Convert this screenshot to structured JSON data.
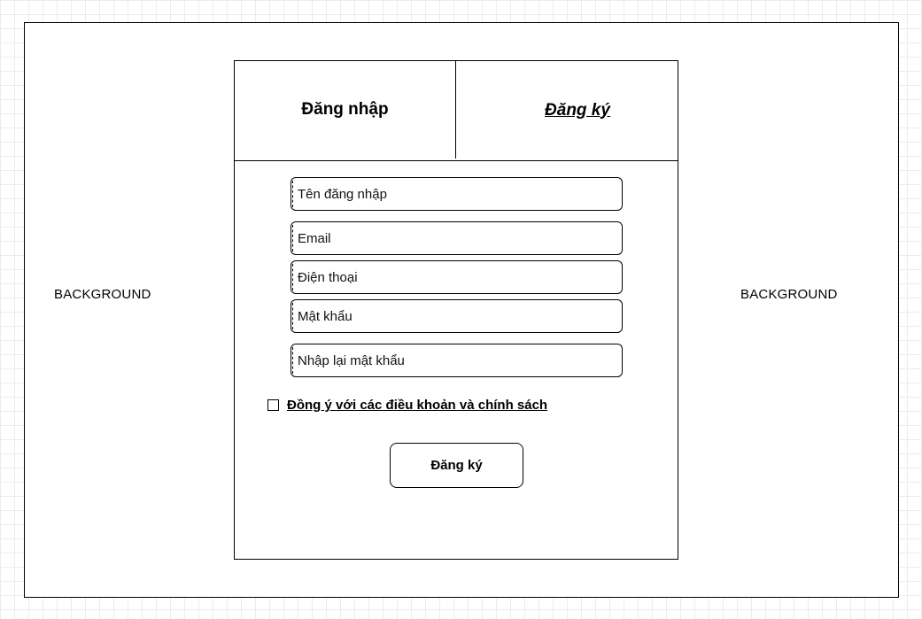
{
  "background": {
    "left_label": "BACKGROUND",
    "right_label": "BACKGROUND"
  },
  "tabs": {
    "login": "Đăng nhập",
    "register": "Đăng ký"
  },
  "form": {
    "username_placeholder": "Tên đăng nhập",
    "email_placeholder": "Email",
    "phone_placeholder": "Điện thoại",
    "password_placeholder": "Mật khẩu",
    "confirm_password_placeholder": "Nhập lại mật khẩu",
    "agree_label": "Đồng ý với các điều khoản và chính sách",
    "agree_checked": false,
    "submit_label": "Đăng ký"
  }
}
